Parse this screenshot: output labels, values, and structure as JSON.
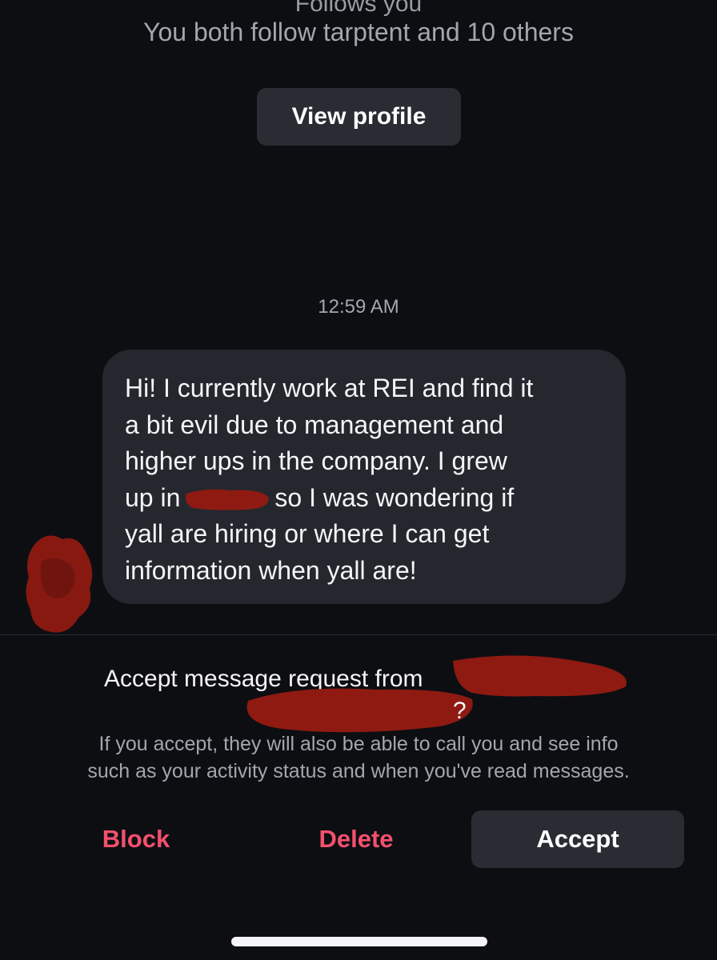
{
  "profile": {
    "cut_line": "Follows you",
    "mutuals": "You both follow tarptent and 10 others",
    "view_profile_label": "View profile"
  },
  "thread": {
    "timestamp": "12:59 AM",
    "message_lines": [
      "Hi! I currently work at REI and find it",
      "a bit evil due to management and",
      "higher ups in the company. I grew",
      "up in",
      "so I was wondering if",
      "yall are hiring or where I can get",
      "information when yall are!"
    ]
  },
  "request": {
    "prompt": "Accept message request from",
    "question_mark": "?",
    "info_line1": "If you accept, they will also be able to call you and see info",
    "info_line2": "such as your activity status and when you've read messages.",
    "block_label": "Block",
    "delete_label": "Delete",
    "accept_label": "Accept"
  },
  "colors": {
    "background": "#0d0e12",
    "button_bg": "#2a2c33",
    "bubble_bg": "#25272e",
    "destructive": "#f4506e",
    "redaction": "#8e1a12"
  }
}
